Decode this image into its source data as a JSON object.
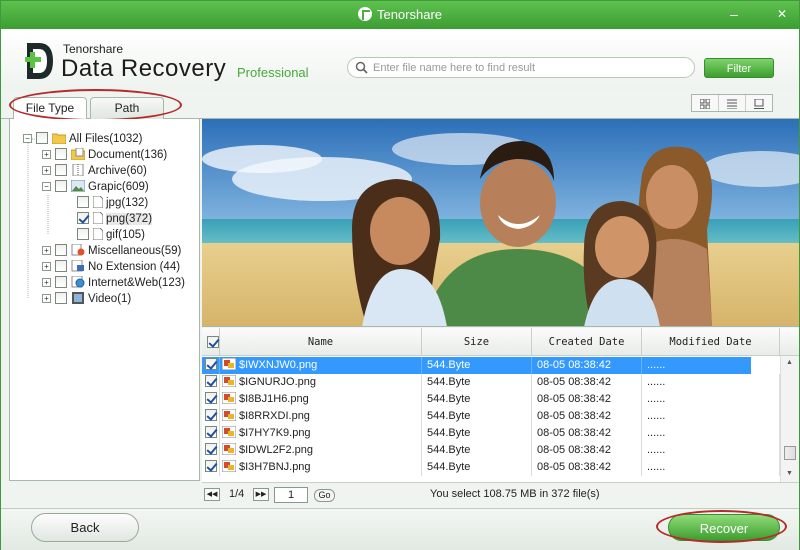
{
  "window": {
    "title": "Tenorshare",
    "minimize": "–",
    "close": "✕"
  },
  "brand": {
    "line1": "Tenorshare",
    "line2": "Data Recovery",
    "edition": "Professional"
  },
  "search": {
    "placeholder": "Enter file name here to find result"
  },
  "filter_label": "Filter",
  "tabs": [
    {
      "label": "File Type"
    },
    {
      "label": "Path"
    }
  ],
  "tree": {
    "all": "All Files(1032)",
    "items": [
      {
        "label": "Document(136)"
      },
      {
        "label": "Archive(60)"
      },
      {
        "label": "Grapic(609)"
      },
      {
        "label": "jpg(132)"
      },
      {
        "label": "png(372)"
      },
      {
        "label": "gif(105)"
      },
      {
        "label": "Miscellaneous(59)"
      },
      {
        "label": "No Extension (44)"
      },
      {
        "label": "Internet&Web(123)"
      },
      {
        "label": "Video(1)"
      }
    ]
  },
  "table": {
    "headers": {
      "name": "Name",
      "size": "Size",
      "created": "Created Date",
      "modified": "Modified Date"
    },
    "rows": [
      {
        "name": "$IWXNJW0.png",
        "size": "544.Byte",
        "created": "08-05 08:38:42",
        "modified": "......"
      },
      {
        "name": "$IGNURJO.png",
        "size": "544.Byte",
        "created": "08-05 08:38:42",
        "modified": "......"
      },
      {
        "name": "$I8BJ1H6.png",
        "size": "544.Byte",
        "created": "08-05 08:38:42",
        "modified": "......"
      },
      {
        "name": "$I8RRXDI.png",
        "size": "544.Byte",
        "created": "08-05 08:38:42",
        "modified": "......"
      },
      {
        "name": "$I7HY7K9.png",
        "size": "544.Byte",
        "created": "08-05 08:38:42",
        "modified": "......"
      },
      {
        "name": "$IDWL2F2.png",
        "size": "544.Byte",
        "created": "08-05 08:38:42",
        "modified": "......"
      },
      {
        "name": "$I3H7BNJ.png",
        "size": "544.Byte",
        "created": "08-05 08:38:42",
        "modified": "......"
      }
    ]
  },
  "pager": {
    "page": "1/4",
    "input": "1",
    "go": "Go"
  },
  "status": "You select 108.75 MB in 372 file(s)",
  "back_label": "Back",
  "recover_label": "Recover"
}
